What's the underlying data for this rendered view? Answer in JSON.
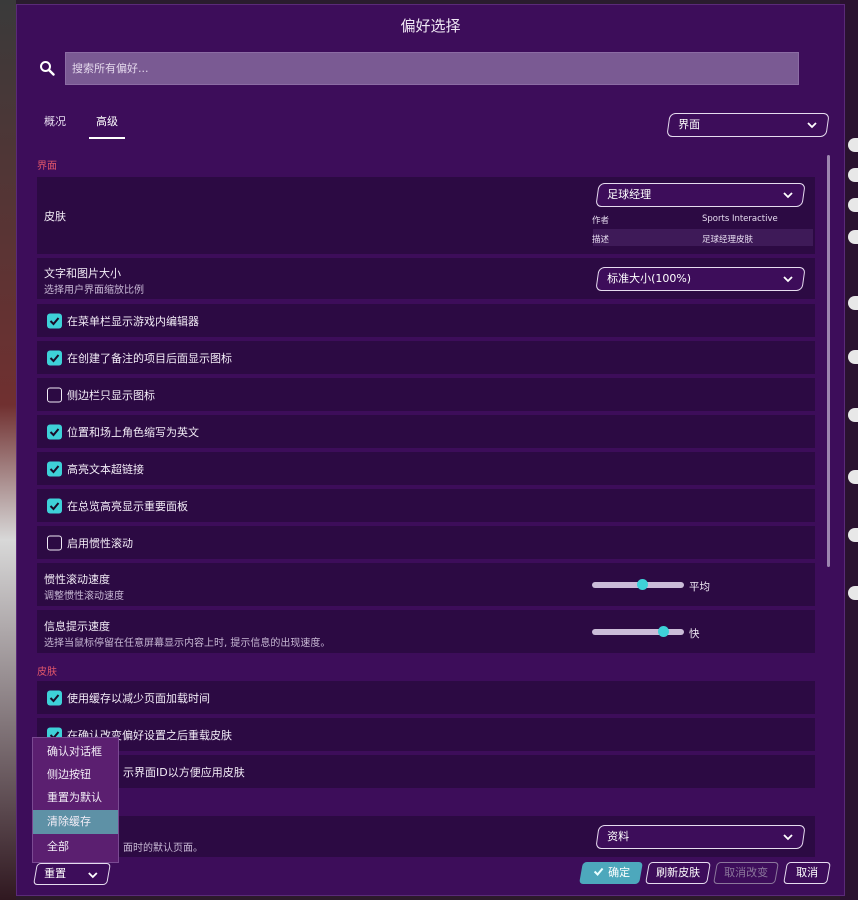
{
  "dialog": {
    "title": "偏好选择"
  },
  "search": {
    "placeholder": "搜索所有偏好..."
  },
  "tabs": [
    {
      "label": "概况"
    },
    {
      "label": "高级"
    }
  ],
  "category_dropdown": {
    "value": "界面"
  },
  "sections": {
    "interface": "界面",
    "skin": "皮肤"
  },
  "skin_setting": {
    "label": "皮肤",
    "value": "足球经理",
    "meta": [
      {
        "key": "作者",
        "value": "Sports Interactive"
      },
      {
        "key": "描述",
        "value": "足球经理皮肤"
      }
    ]
  },
  "text_size": {
    "label": "文字和图片大小",
    "sub": "选择用户界面缩放比例",
    "value": "标准大小(100%)"
  },
  "checkboxes": [
    {
      "label": "在菜单栏显示游戏内编辑器",
      "checked": true
    },
    {
      "label": "在创建了备注的项目后面显示图标",
      "checked": true
    },
    {
      "label": "侧边栏只显示图标",
      "checked": false
    },
    {
      "label": "位置和场上角色缩写为英文",
      "checked": true
    },
    {
      "label": "高亮文本超链接",
      "checked": true
    },
    {
      "label": "在总览高亮显示重要面板",
      "checked": true
    },
    {
      "label": "启用惯性滚动",
      "checked": false
    }
  ],
  "inertia": {
    "label": "惯性滚动速度",
    "sub": "调整惯性滚动速度",
    "value_label": "平均",
    "level": 0.55
  },
  "tooltip": {
    "label": "信息提示速度",
    "sub": "选择当鼠标停留在任意屏幕显示内容上时, 提示信息的出现速度。",
    "value_label": "快",
    "level": 0.78
  },
  "skin_checkboxes": [
    {
      "label": "使用缓存以减少页面加载时间",
      "checked": true
    },
    {
      "label": "在确认改变偏好设置之后重载皮肤",
      "checked": true
    },
    {
      "label": "示界面ID以方便应用皮肤",
      "checked": false
    }
  ],
  "default_page": {
    "sub": "面时的默认页面。",
    "value": "资料"
  },
  "popup_menu": [
    {
      "label": "确认对话框"
    },
    {
      "label": "侧边按钮"
    },
    {
      "label": "重置为默认"
    },
    {
      "label": "清除缓存"
    },
    {
      "label": "全部"
    }
  ],
  "footer": {
    "reset": "重置",
    "ok": "确定",
    "refresh_skin": "刷新皮肤",
    "cancel_changes": "取消改变",
    "cancel": "取消"
  },
  "colors": {
    "accent": "#3ed1d8",
    "panel": "#3d0d5a",
    "row": "#2c0a43",
    "section": "#e0566a"
  }
}
